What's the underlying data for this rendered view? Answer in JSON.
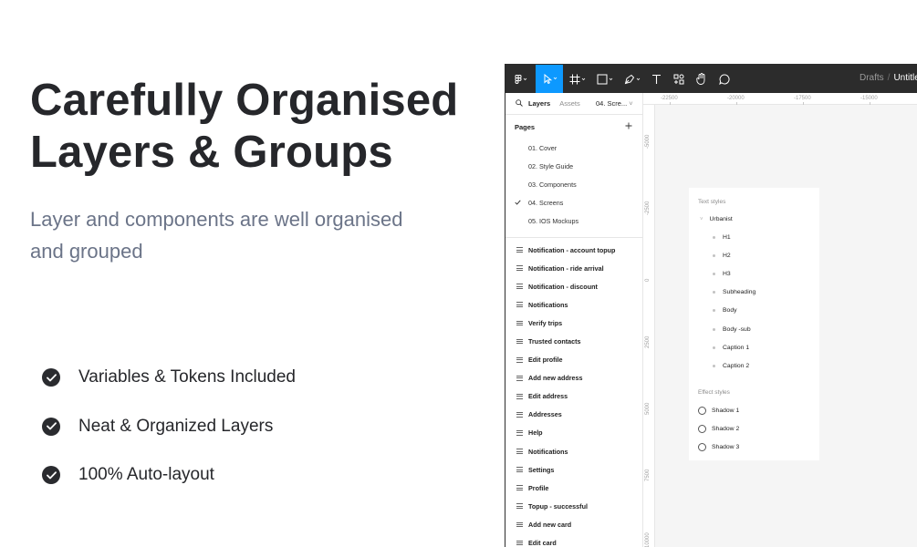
{
  "headline": {
    "line1": "Carefully Organised",
    "line2": "Layers & Groups"
  },
  "subtitle": {
    "line1": "Layer and components are well organised",
    "line2": "and grouped"
  },
  "features": [
    {
      "label": "Variables & Tokens Included",
      "icon": "check-circle-icon"
    },
    {
      "label": "Neat & Organized Layers",
      "icon": "check-circle-icon"
    },
    {
      "label": "100% Auto-layout",
      "icon": "check-circle-icon"
    }
  ],
  "toolbar": {
    "tools": [
      "main-menu-icon",
      "move-tool-icon",
      "frame-tool-icon",
      "shape-tool-icon",
      "pen-tool-icon",
      "text-tool-icon",
      "components-icon",
      "hand-tool-icon",
      "comment-icon"
    ],
    "active_tool": "move-tool-icon",
    "breadcrumb_parent": "Drafts",
    "breadcrumb_sep": "/",
    "file_name": "Untitled"
  },
  "panel": {
    "tab_layers": "Layers",
    "tab_assets": "Assets",
    "current_page": "04. Scre...",
    "pages_title": "Pages",
    "pages": [
      "01. Cover",
      "02. Style Guide",
      "03. Components",
      "04. Screens",
      "05. IOS Mockups"
    ],
    "active_page_index": 3,
    "layers": [
      "Notification - account topup",
      "Notification - ride arrival",
      "Notification - discount",
      "Notifications",
      "Verify trips",
      "Trusted contacts",
      "Edit profile",
      "Add new address",
      "Edit address",
      "Addresses",
      "Help",
      "Notifications",
      "Settings",
      "Profile",
      "Topup - successful",
      "Add new card",
      "Edit card"
    ]
  },
  "canvas": {
    "ruler_top": [
      "-22500",
      "-20000",
      "-17500",
      "-15000"
    ],
    "ruler_left": [
      "-5000",
      "-2500",
      "0",
      "2500",
      "5000",
      "7500",
      "10000"
    ],
    "text_styles_title": "Text styles",
    "font_group": "Urbanist",
    "text_styles": [
      "H1",
      "H2",
      "H3",
      "Subheading",
      "Body",
      "Body -sub",
      "Caption 1",
      "Caption 2"
    ],
    "effect_styles_title": "Effect styles",
    "effect_styles": [
      "Shadow 1",
      "Shadow 2",
      "Shadow 3"
    ]
  },
  "colors": {
    "accent": "#0d99ff",
    "toolbar": "#2c2c2c",
    "canvas": "#f5f5f5",
    "subtitle": "#6b7488"
  }
}
